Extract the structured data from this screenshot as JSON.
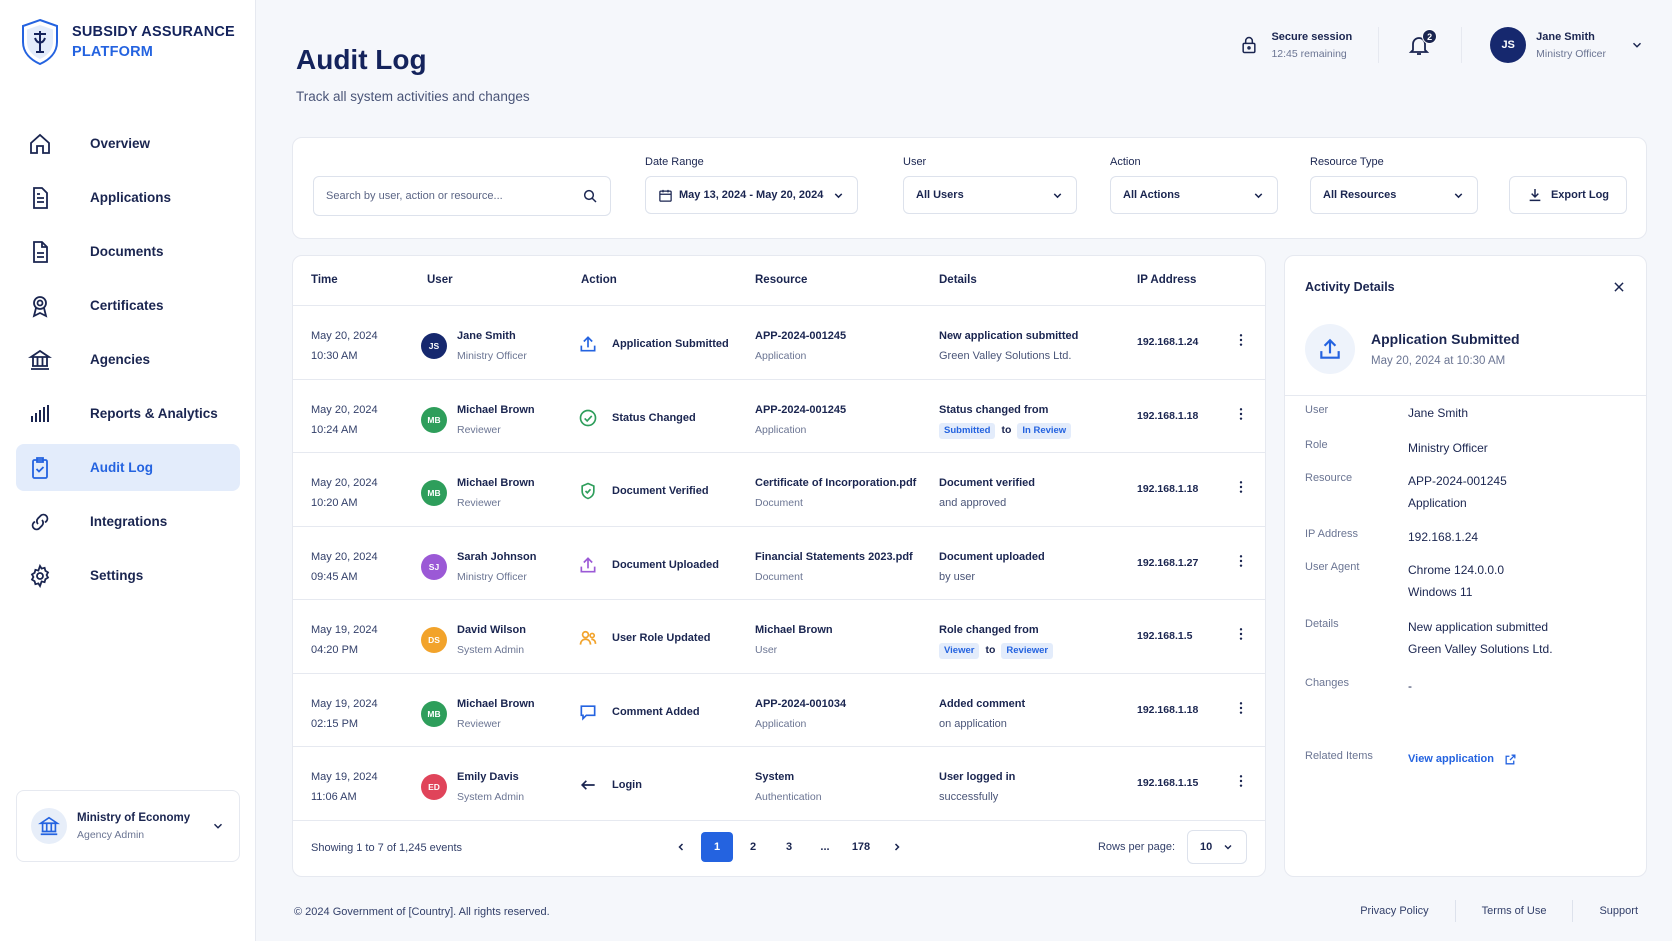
{
  "brand": {
    "line1": "SUBSIDY ASSURANCE",
    "line2": "PLATFORM"
  },
  "nav": [
    {
      "label": "Overview",
      "icon": "home-icon",
      "active": false
    },
    {
      "label": "Applications",
      "icon": "file-icon",
      "active": false
    },
    {
      "label": "Documents",
      "icon": "document-icon",
      "active": false
    },
    {
      "label": "Certificates",
      "icon": "award-icon",
      "active": false
    },
    {
      "label": "Agencies",
      "icon": "bank-icon",
      "active": false
    },
    {
      "label": "Reports & Analytics",
      "icon": "bar-chart-icon",
      "active": false
    },
    {
      "label": "Audit Log",
      "icon": "clipboard-check-icon",
      "active": true
    },
    {
      "label": "Integrations",
      "icon": "link-icon",
      "active": false
    },
    {
      "label": "Settings",
      "icon": "gear-icon",
      "active": false
    }
  ],
  "agency": {
    "name": "Ministry of Economy",
    "role": "Agency Admin"
  },
  "header": {
    "title": "Audit Log",
    "subtitle": "Track all system activities and changes"
  },
  "session": {
    "title": "Secure session",
    "remaining": "12:45 remaining"
  },
  "notifications": {
    "count": "2"
  },
  "current_user": {
    "initials": "JS",
    "name": "Jane Smith",
    "role": "Ministry Officer"
  },
  "filters": {
    "search_placeholder": "Search by user, action or resource...",
    "date_label": "Date Range",
    "date_value": "May 13, 2024 - May 20, 2024",
    "user_label": "User",
    "user_value": "All Users",
    "action_label": "Action",
    "action_value": "All Actions",
    "resource_label": "Resource Type",
    "resource_value": "All Resources",
    "export_label": "Export Log"
  },
  "table": {
    "columns": [
      "Time",
      "User",
      "Action",
      "Resource",
      "Details",
      "IP Address"
    ],
    "rows": [
      {
        "date": "May 20, 2024",
        "time": "10:30 AM",
        "initials": "JS",
        "avatar_color": "#16286e",
        "user": "Jane Smith",
        "role": "Ministry Officer",
        "action": "Application Submitted",
        "action_icon": "upload-icon",
        "action_color": "#2463e0",
        "resource": "APP-2024-001245",
        "resource_type": "Application",
        "detail_a": "New application submitted",
        "detail_b": "Green Valley Solutions Ltd.",
        "chip_from": "",
        "chip_to": "",
        "ip": "192.168.1.24"
      },
      {
        "date": "May 20, 2024",
        "time": "10:24 AM",
        "initials": "MB",
        "avatar_color": "#2e9e5b",
        "user": "Michael Brown",
        "role": "Reviewer",
        "action": "Status Changed",
        "action_icon": "check-circle-icon",
        "action_color": "#2e9e5b",
        "resource": "APP-2024-001245",
        "resource_type": "Application",
        "detail_a": "Status changed from",
        "detail_b": "",
        "chip_from": "Submitted",
        "chip_to": "In Review",
        "ip": "192.168.1.18"
      },
      {
        "date": "May 20, 2024",
        "time": "10:20 AM",
        "initials": "MB",
        "avatar_color": "#2e9e5b",
        "user": "Michael Brown",
        "role": "Reviewer",
        "action": "Document Verified",
        "action_icon": "shield-check-icon",
        "action_color": "#2e9e5b",
        "resource": "Certificate of Incorporation.pdf",
        "resource_type": "Document",
        "detail_a": "Document verified",
        "detail_b": "and approved",
        "chip_from": "",
        "chip_to": "",
        "ip": "192.168.1.18"
      },
      {
        "date": "May 20, 2024",
        "time": "09:45 AM",
        "initials": "SJ",
        "avatar_color": "#9b59d6",
        "user": "Sarah Johnson",
        "role": "Ministry Officer",
        "action": "Document Uploaded",
        "action_icon": "upload-icon",
        "action_color": "#9b59d6",
        "resource": "Financial Statements 2023.pdf",
        "resource_type": "Document",
        "detail_a": "Document uploaded",
        "detail_b": "by user",
        "chip_from": "",
        "chip_to": "",
        "ip": "192.168.1.27"
      },
      {
        "date": "May 19, 2024",
        "time": "04:20 PM",
        "initials": "DS",
        "avatar_color": "#f2a32b",
        "user": "David Wilson",
        "role": "System Admin",
        "action": "User Role Updated",
        "action_icon": "users-icon",
        "action_color": "#f2a32b",
        "resource": "Michael Brown",
        "resource_type": "User",
        "detail_a": "Role changed from",
        "detail_b": "",
        "chip_from": "Viewer",
        "chip_to": "Reviewer",
        "ip": "192.168.1.5"
      },
      {
        "date": "May 19, 2024",
        "time": "02:15 PM",
        "initials": "MB",
        "avatar_color": "#2e9e5b",
        "user": "Michael Brown",
        "role": "Reviewer",
        "action": "Comment Added",
        "action_icon": "comment-icon",
        "action_color": "#2463e0",
        "resource": "APP-2024-001034",
        "resource_type": "Application",
        "detail_a": "Added comment",
        "detail_b": "on application",
        "chip_from": "",
        "chip_to": "",
        "ip": "192.168.1.18"
      },
      {
        "date": "May 19, 2024",
        "time": "11:06 AM",
        "initials": "ED",
        "avatar_color": "#e0445a",
        "user": "Emily Davis",
        "role": "System Admin",
        "action": "Login",
        "action_icon": "login-icon",
        "action_color": "#1a2550",
        "resource": "System",
        "resource_type": "Authentication",
        "detail_a": "User logged in",
        "detail_b": "successfully",
        "chip_from": "",
        "chip_to": "",
        "ip": "192.168.1.15"
      }
    ],
    "chip_joiner": "to",
    "showing": "Showing 1 to 7 of 1,245 events",
    "pages": [
      "1",
      "2",
      "3",
      "...",
      "178"
    ],
    "active_page": "1",
    "rows_per_page_label": "Rows per page:",
    "rows_per_page_value": "10"
  },
  "details": {
    "title": "Activity Details",
    "action": "Application Submitted",
    "timestamp": "May 20, 2024 at 10:30 AM",
    "fields": [
      {
        "key": "User",
        "lines": [
          "Jane Smith"
        ]
      },
      {
        "key": "Role",
        "lines": [
          "Ministry Officer"
        ]
      },
      {
        "key": "Resource",
        "lines": [
          "APP-2024-001245",
          "Application"
        ]
      },
      {
        "key": "IP Address",
        "lines": [
          "192.168.1.24"
        ]
      },
      {
        "key": "User Agent",
        "lines": [
          "Chrome 124.0.0.0",
          "Windows 11"
        ]
      },
      {
        "key": "Details",
        "lines": [
          "New application submitted",
          "Green Valley Solutions Ltd."
        ]
      },
      {
        "key": "Changes",
        "lines": [
          "-"
        ]
      }
    ],
    "related_key": "Related Items",
    "related_link": "View application"
  },
  "footer": {
    "copyright": "© 2024 Government of [Country]. All rights reserved.",
    "links": [
      "Privacy Policy",
      "Terms of Use",
      "Support"
    ]
  },
  "colors": {
    "accent": "#2463e0",
    "navy": "#14235c",
    "active_bg": "#e3ecfb"
  }
}
